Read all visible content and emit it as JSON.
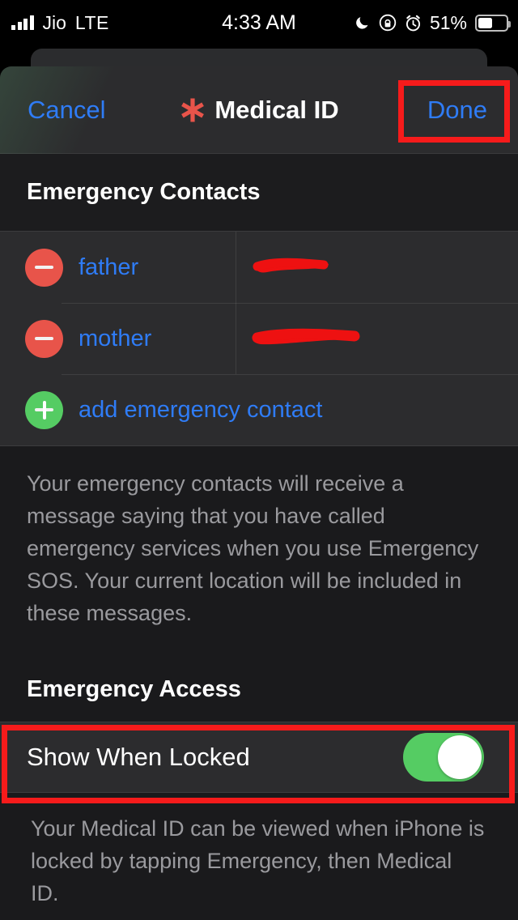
{
  "status_bar": {
    "carrier": "Jio",
    "network": "LTE",
    "time": "4:33 AM",
    "battery_percent": "51%",
    "icons": [
      "signal-bars-icon",
      "moon-icon",
      "rotation-lock-icon",
      "alarm-icon",
      "battery-icon"
    ]
  },
  "navbar": {
    "cancel_label": "Cancel",
    "title": "Medical ID",
    "title_icon": "medical-asterisk-icon",
    "done_label": "Done",
    "accent_blue": "#2F7CF6",
    "asterisk_red": "#E8544A"
  },
  "sections": [
    {
      "header": "Emergency Contacts",
      "rows": [
        {
          "action_icon": "minus-circle-icon",
          "label": "father",
          "value": "",
          "value_redacted": true
        },
        {
          "action_icon": "minus-circle-icon",
          "label": "mother",
          "value": "",
          "value_redacted": true
        },
        {
          "action_icon": "plus-circle-icon",
          "label": "add emergency contact",
          "value": "",
          "value_redacted": false
        }
      ],
      "footer": "Your emergency contacts will receive a message saying that you have called emergency services when you use Emergency SOS. Your current location will be included in these messages."
    },
    {
      "header": "Emergency Access",
      "switch_row": {
        "label": "Show When Locked",
        "state": "on",
        "on_color": "#55CC63"
      },
      "footer": "Your Medical ID can be viewed when iPhone is locked by tapping Emergency, then Medical ID."
    }
  ],
  "annotations": {
    "highlight_color": "#F61B1B",
    "boxes": [
      "done-button",
      "show-when-locked-row"
    ],
    "redaction_color": "#EE1111"
  }
}
